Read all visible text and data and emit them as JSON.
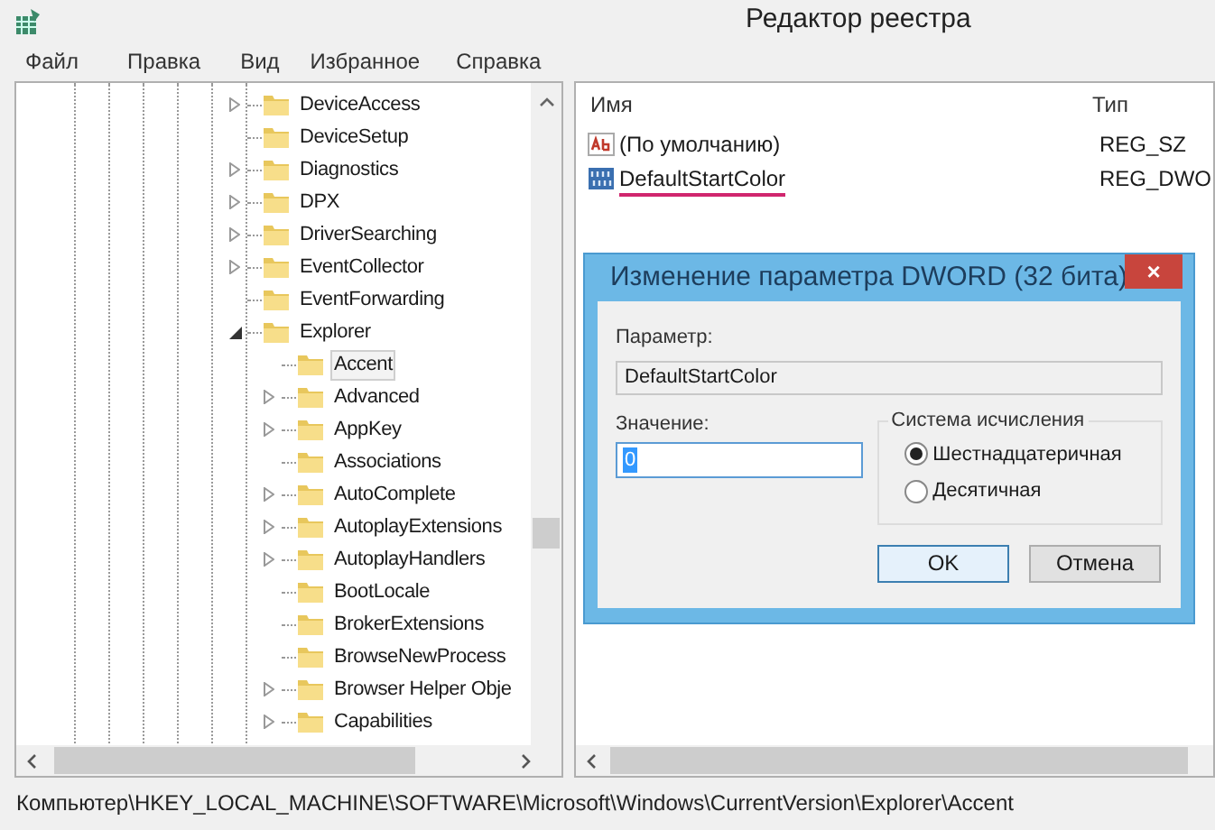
{
  "window": {
    "title": "Редактор реестра"
  },
  "menu": [
    "Файл",
    "Правка",
    "Вид",
    "Избранное",
    "Справка"
  ],
  "tree": [
    {
      "label": "DeviceAccess",
      "expandable": true,
      "expanded": false,
      "selected": false
    },
    {
      "label": "DeviceSetup",
      "expandable": false,
      "selected": false
    },
    {
      "label": "Diagnostics",
      "expandable": true,
      "expanded": false,
      "selected": false
    },
    {
      "label": "DPX",
      "expandable": true,
      "expanded": false,
      "selected": false
    },
    {
      "label": "DriverSearching",
      "expandable": true,
      "expanded": false,
      "selected": false
    },
    {
      "label": "EventCollector",
      "expandable": true,
      "expanded": false,
      "selected": false
    },
    {
      "label": "EventForwarding",
      "expandable": false,
      "selected": false
    },
    {
      "label": "Explorer",
      "expandable": true,
      "expanded": true,
      "selected": false,
      "children": [
        {
          "label": "Accent",
          "expandable": false,
          "selected": true
        },
        {
          "label": "Advanced",
          "expandable": true,
          "expanded": false,
          "selected": false
        },
        {
          "label": "AppKey",
          "expandable": true,
          "expanded": false,
          "selected": false
        },
        {
          "label": "Associations",
          "expandable": false,
          "selected": false
        },
        {
          "label": "AutoComplete",
          "expandable": true,
          "expanded": false,
          "selected": false
        },
        {
          "label": "AutoplayExtensions",
          "expandable": true,
          "expanded": false,
          "selected": false
        },
        {
          "label": "AutoplayHandlers",
          "expandable": true,
          "expanded": false,
          "selected": false
        },
        {
          "label": "BootLocale",
          "expandable": false,
          "selected": false
        },
        {
          "label": "BrokerExtensions",
          "expandable": false,
          "selected": false
        },
        {
          "label": "BrowseNewProcess",
          "expandable": false,
          "selected": false
        },
        {
          "label": "Browser Helper Obje",
          "expandable": true,
          "expanded": false,
          "selected": false
        },
        {
          "label": "Capabilities",
          "expandable": true,
          "expanded": false,
          "selected": false
        }
      ]
    }
  ],
  "values": {
    "columns": [
      "Имя",
      "Тип"
    ],
    "rows": [
      {
        "kind": "string",
        "name": "(По умолчанию)",
        "type": "REG_SZ",
        "underlined": false
      },
      {
        "kind": "binary",
        "name": "DefaultStartColor",
        "type": "REG_DWO",
        "underlined": true
      }
    ]
  },
  "dialog": {
    "title": "Изменение параметра DWORD (32 бита)",
    "close": "×",
    "name_label": "Параметр:",
    "name_value": "DefaultStartColor",
    "value_label": "Значение:",
    "value": "0",
    "base_group": "Система исчисления",
    "bases": [
      {
        "label": "Шестнадцатеричная",
        "selected": true
      },
      {
        "label": "Десятичная",
        "selected": false
      }
    ],
    "buttons": [
      {
        "label": "OK",
        "default": true
      },
      {
        "label": "Отмена",
        "default": false
      }
    ]
  },
  "status_bar": "Компьютер\\HKEY_LOCAL_MACHINE\\SOFTWARE\\Microsoft\\Windows\\CurrentVersion\\Explorer\\Accent"
}
